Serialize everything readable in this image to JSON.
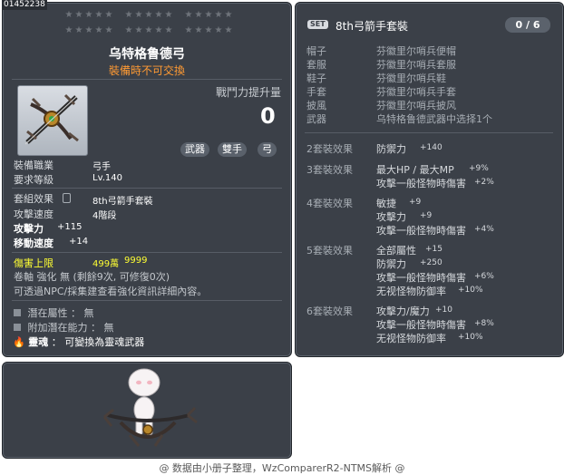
{
  "item": {
    "id": "01452238",
    "name": "乌特格鲁德弓",
    "trade_note": "裝備時不可交換",
    "power_label": "戰鬥力提升量",
    "power_value": "0",
    "tags": [
      "武器",
      "雙手",
      "弓"
    ],
    "job_label": "裝備職業",
    "job_value": "弓手",
    "level_label": "要求等級",
    "level_value": "Lv.140",
    "set_label": "套組效果",
    "set_value": "8th弓箭手套裝",
    "speed_label": "攻擊速度",
    "speed_value": "4階段",
    "atk_label": "攻擊力",
    "atk_value": "+115",
    "move_label": "移動速度",
    "move_value": "+14",
    "cap_label": "傷害上限",
    "cap_value1": "499萬",
    "cap_value2": "9999",
    "scroll_note": "卷軸 強化 無 (剩餘9次, 可修復0次)",
    "npc_note": "可透過NPC/採集建查看強化資訊詳細內容。",
    "potential_label": "潛在屬性 ： 無",
    "add_potential_label": "附加潛在能力 ： 無",
    "soul_label": "靈魂",
    "soul_value": "： 可變換為靈魂武器"
  },
  "set": {
    "badge": "SET",
    "title": "8th弓箭手套裝",
    "count": "0 / 6",
    "pieces": [
      {
        "slot": "帽子",
        "name": "芬徽里尔哨兵便帽"
      },
      {
        "slot": "套服",
        "name": "芬徽里尔哨兵套服"
      },
      {
        "slot": "鞋子",
        "name": "芬徽里尔哨兵鞋"
      },
      {
        "slot": "手套",
        "name": "芬徽里尔哨兵手套"
      },
      {
        "slot": "披風",
        "name": "芬徽里尔哨兵披风"
      },
      {
        "slot": "武器",
        "name": "乌特格鲁德武器中选择1个"
      }
    ],
    "effects": [
      {
        "label": "2套裝效果",
        "lines": [
          [
            "防禦力",
            "+140"
          ]
        ]
      },
      {
        "label": "3套裝效果",
        "lines": [
          [
            "最大HP / 最大MP",
            "+9%"
          ],
          [
            "攻擊一般怪物時傷害",
            "+2%"
          ]
        ]
      },
      {
        "label": "4套裝效果",
        "lines": [
          [
            "敏捷",
            "+9"
          ],
          [
            "攻擊力",
            "+9"
          ],
          [
            "攻擊一般怪物時傷害",
            "+4%"
          ]
        ]
      },
      {
        "label": "5套裝效果",
        "lines": [
          [
            "全部屬性",
            "+15"
          ],
          [
            "防禦力",
            "+250"
          ],
          [
            "攻擊一般怪物時傷害",
            "+6%"
          ],
          [
            "无视怪物防御率",
            "+10%"
          ]
        ]
      },
      {
        "label": "6套裝效果",
        "lines": [
          [
            "攻擊力/魔力",
            "+10"
          ],
          [
            "攻擊一般怪物時傷害",
            "+8%"
          ],
          [
            "无视怪物防御率",
            "+10%"
          ]
        ]
      }
    ]
  },
  "footer": "@ 数据由小册子整理，WzComparerR2-NTMS解析 @",
  "colors": {
    "panel": "#3b4048",
    "trade_note": "#ff9a33",
    "damage_cap": "#ffff33"
  }
}
